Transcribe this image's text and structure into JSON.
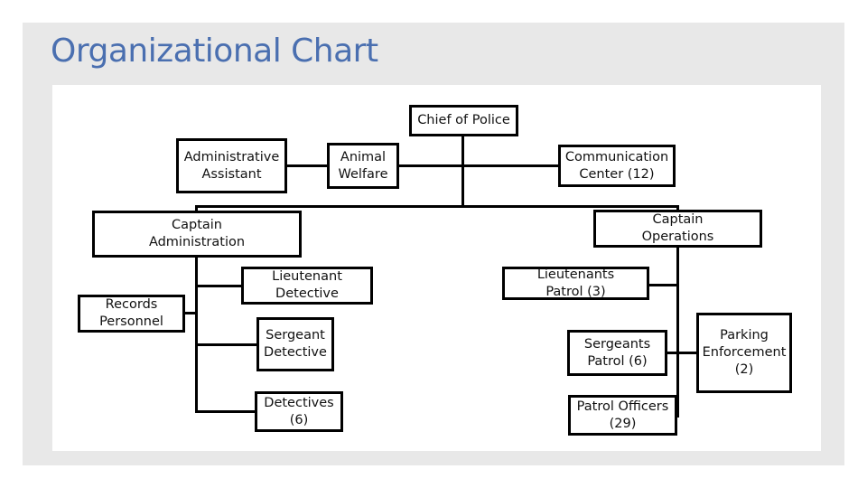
{
  "slide": {
    "title": "Organizational Chart"
  },
  "org_chart": {
    "nodes": {
      "chief": "Chief of Police",
      "admin_assistant": "Administrative\nAssistant",
      "animal_welfare": "Animal\nWelfare",
      "communication_center": "Communication\nCenter (12)",
      "captain_admin": "Captain\nAdministration",
      "captain_ops": "Captain\nOperations",
      "records": "Records\nPersonnel",
      "lt_detective": "Lieutenant\nDetective",
      "sgt_detective": "Sergeant\nDetective",
      "detectives": "Detectives\n(6)",
      "lt_patrol": "Lieutenants\nPatrol (3)",
      "sgt_patrol": "Sergeants\nPatrol (6)",
      "patrol_officers": "Patrol Officers\n(29)",
      "parking": "Parking\nEnforcement\n(2)"
    },
    "edges": [
      [
        "chief",
        "animal_welfare"
      ],
      [
        "chief",
        "communication_center"
      ],
      [
        "animal_welfare",
        "admin_assistant"
      ],
      [
        "chief",
        "captain_admin"
      ],
      [
        "chief",
        "captain_ops"
      ],
      [
        "captain_admin",
        "records"
      ],
      [
        "captain_admin",
        "lt_detective"
      ],
      [
        "captain_admin",
        "sgt_detective"
      ],
      [
        "captain_admin",
        "detectives"
      ],
      [
        "captain_ops",
        "lt_patrol"
      ],
      [
        "captain_ops",
        "sgt_patrol"
      ],
      [
        "captain_ops",
        "parking"
      ],
      [
        "captain_ops",
        "patrol_officers"
      ]
    ]
  }
}
